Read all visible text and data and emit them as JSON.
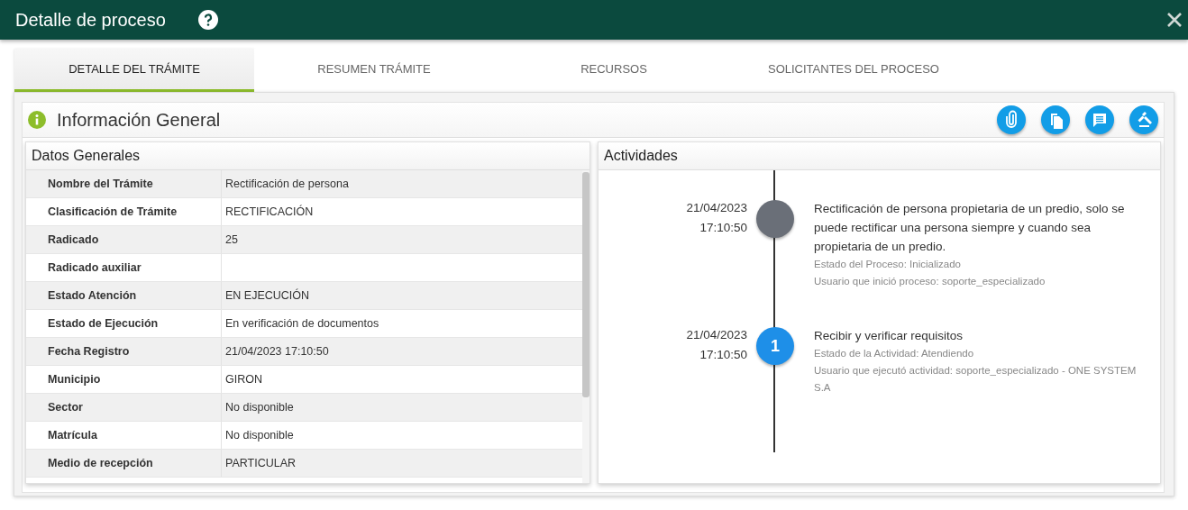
{
  "window": {
    "title": "Detalle de proceso"
  },
  "tabs": [
    {
      "label": "DETALLE DEL TRÁMITE",
      "selected": true
    },
    {
      "label": "RESUMEN TRÁMITE",
      "selected": false
    },
    {
      "label": "RECURSOS",
      "selected": false
    },
    {
      "label": "SOLICITANTES DEL PROCESO",
      "selected": false
    }
  ],
  "section": {
    "title": "Información General",
    "actions": [
      {
        "kind": "attach"
      },
      {
        "kind": "copy"
      },
      {
        "kind": "comment"
      },
      {
        "kind": "gavel"
      }
    ]
  },
  "general": {
    "title": "Datos Generales",
    "rows": [
      {
        "label": "Nombre del Trámite",
        "value": "Rectificación de persona"
      },
      {
        "label": "Clasificación de Trámite",
        "value": "RECTIFICACIÓN"
      },
      {
        "label": "Radicado",
        "value": "25"
      },
      {
        "label": "Radicado auxiliar"
      },
      {
        "label": "Estado Atención",
        "value": "EN EJECUCIÓN"
      },
      {
        "label": "Estado de Ejecución",
        "value": "En verificación de documentos"
      },
      {
        "label": "Fecha Registro",
        "value": "21/04/2023 17:10:50"
      },
      {
        "label": "Municipio",
        "value": "GIRON"
      },
      {
        "label": "Sector",
        "value": "No disponible"
      },
      {
        "label": "Matrícula",
        "value": "No disponible"
      },
      {
        "label": "Medio de recepción",
        "value": "PARTICULAR"
      }
    ]
  },
  "activities": {
    "title": "Actividades",
    "items": [
      {
        "kind": "process",
        "date": "21/04/2023",
        "time": "17:10:50",
        "title": "Rectificación de persona propietaria de un predio, solo se puede rectificar una persona siempre y cuando sea propietaria de un predio.",
        "details": [
          "Estado del Proceso: Inicializado",
          "Usuario que inició proceso: soporte_especializado"
        ]
      },
      {
        "kind": "activity",
        "marker": "1",
        "date": "21/04/2023",
        "time": "17:10:50",
        "title": "Recibir y verificar requisitos",
        "details": [
          "Estado de la Actividad: Atendiendo",
          "Usuario que ejecutó actividad: soporte_especializado - ONE SYSTEM S.A"
        ]
      }
    ]
  }
}
